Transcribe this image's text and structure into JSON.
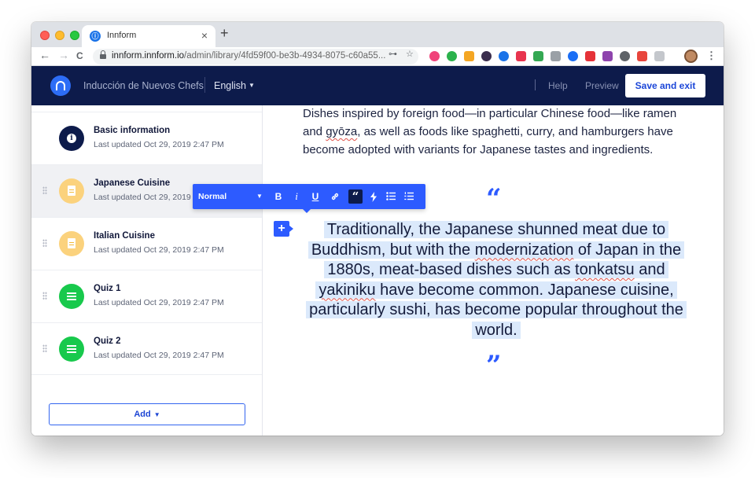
{
  "browser": {
    "tab_title": "Innform",
    "tab_favicon": "innform-logo-icon",
    "tab_close": "×",
    "new_tab": "+",
    "url_host": "innform.innform.io",
    "url_path": "/admin/library/4fd59f00-be3b-4934-8075-c60a55...",
    "nav": {
      "back": "←",
      "forward": "→",
      "reload": "C"
    },
    "omni_icons": [
      "key-icon",
      "star-icon"
    ],
    "extensions": [
      {
        "name": "ext-ring-icon",
        "color": "#f0437a"
      },
      {
        "name": "ext-green-circle-icon",
        "color": "#2bb24c"
      },
      {
        "name": "ext-multicolor-icon",
        "color": "#f4a623"
      },
      {
        "name": "ext-dark-circle-icon",
        "color": "#3a2d4d"
      },
      {
        "name": "ext-blue-eye-icon",
        "color": "#1a73e8"
      },
      {
        "name": "ext-red-r-icon",
        "color": "#e8344e"
      },
      {
        "name": "ext-green-calendar-icon",
        "color": "#34a853"
      },
      {
        "name": "ext-cloud-icon",
        "color": "#9aa0a6"
      },
      {
        "name": "ext-1password-icon",
        "color": "#1a6ef5"
      },
      {
        "name": "ext-ebay-icon",
        "color": "#e53238"
      },
      {
        "name": "ext-purple-square-icon",
        "color": "#8e44ad"
      },
      {
        "name": "ext-info-circle-icon",
        "color": "#5f6368"
      },
      {
        "name": "ext-shield-icon",
        "color": "#e8453c"
      },
      {
        "name": "ext-grey-square-icon",
        "color": "#c4c7cc"
      }
    ]
  },
  "header": {
    "project_name": "Inducción de Nuevos Chefs",
    "language": "English",
    "help": "Help",
    "preview": "Preview",
    "save_label": "Save and exit"
  },
  "sidebar": {
    "items": [
      {
        "title": "Basic information",
        "updated": "Last updated Oct 29, 2019 2:47 PM",
        "icon": "info-icon",
        "color": "navy"
      },
      {
        "title": "Japanese Cuisine",
        "updated": "Last updated Oct 29, 2019 2",
        "icon": "document-icon",
        "color": "yellow"
      },
      {
        "title": "Italian Cuisine",
        "updated": "Last updated Oct 29, 2019 2:47 PM",
        "icon": "document-icon",
        "color": "yellow"
      },
      {
        "title": "Quiz 1",
        "updated": "Last updated Oct 29, 2019 2:47 PM",
        "icon": "list-icon",
        "color": "green"
      },
      {
        "title": "Quiz 2",
        "updated": "Last updated Oct 29, 2019 2:47 PM",
        "icon": "list-icon",
        "color": "green"
      }
    ],
    "add_label": "Add"
  },
  "editor": {
    "intro": {
      "p1": "Dishes inspired by foreign food—in particular Chinese food—like ramen and ",
      "gyoza": "gyōza",
      "p2": ", as well as foods like spaghetti, curry, and hamburgers have become adopted with variants for Japanese tastes and ingredients."
    },
    "quote_open": "“",
    "quote_close": "”",
    "quote": {
      "a": "Traditionally, the Japanese shunned meat due to Buddhism, but with the ",
      "modernization": "modernization",
      "b": " of Japan in the 1880s, meat-based dishes such as ",
      "tonkatsu": "tonkatsu",
      "c": " and ",
      "yakiniku": "yakiniku",
      "d": " have become common. Japanese cuisine, particularly sushi, has become popular throughout the world."
    },
    "add_block": "+"
  },
  "format_toolbar": {
    "style": "Normal",
    "buttons": {
      "bold": "B",
      "italic": "i",
      "underline": "U",
      "link": "link-icon",
      "quote": "“",
      "lightning": "lightning-icon",
      "bullet_list": "bulleted-list-icon",
      "numbered_list": "numbered-list-icon"
    }
  }
}
